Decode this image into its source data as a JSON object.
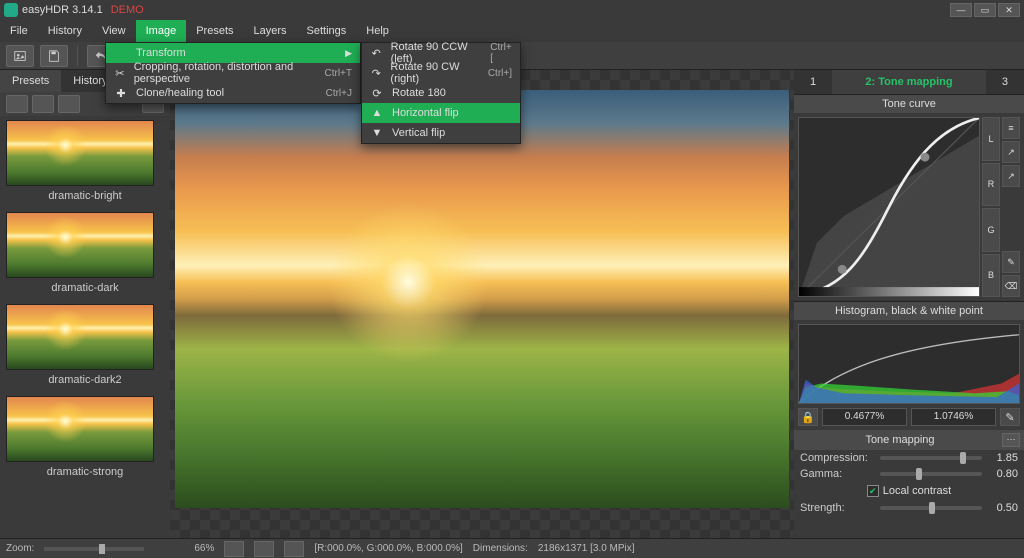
{
  "title": {
    "app": "easyHDR 3.14.1",
    "demo": "DEMO"
  },
  "menubar": [
    "File",
    "History",
    "View",
    "Image",
    "Presets",
    "Layers",
    "Settings",
    "Help"
  ],
  "menubar_active": 3,
  "image_menu": {
    "items": [
      {
        "icon": "",
        "label": "Transform",
        "sub": true
      },
      {
        "icon": "✂",
        "label": "Cropping, rotation, distortion and perspective",
        "shortcut": "Ctrl+T"
      },
      {
        "icon": "✚",
        "label": "Clone/healing tool",
        "shortcut": "Ctrl+J"
      }
    ],
    "active": 0
  },
  "transform_submenu": {
    "items": [
      {
        "icon": "↶",
        "label": "Rotate 90 CCW (left)",
        "shortcut": "Ctrl+["
      },
      {
        "icon": "↷",
        "label": "Rotate 90 CW (right)",
        "shortcut": "Ctrl+]"
      },
      {
        "icon": "⟳",
        "label": "Rotate 180",
        "shortcut": ""
      },
      {
        "icon": "▲",
        "label": "Horizontal flip",
        "shortcut": ""
      },
      {
        "icon": "▼",
        "label": "Vertical flip",
        "shortcut": ""
      }
    ],
    "active": 3
  },
  "left_tabs": {
    "items": [
      "Presets",
      "History"
    ],
    "active": 0
  },
  "presets": [
    {
      "name": "dramatic-bright"
    },
    {
      "name": "dramatic-dark"
    },
    {
      "name": "dramatic-dark2"
    },
    {
      "name": "dramatic-strong"
    }
  ],
  "steps": {
    "one": "1",
    "mid": "2: Tone mapping",
    "three": "3"
  },
  "sections": {
    "tone_curve": "Tone curve",
    "histogram": "Histogram, black & white point",
    "tone_mapping": "Tone mapping"
  },
  "channels": [
    "L",
    "R",
    "G",
    "B"
  ],
  "bw": {
    "black": "0.4677%",
    "white": "1.0746%"
  },
  "tonemap": {
    "compression_label": "Compression:",
    "compression_val": "1.85",
    "gamma_label": "Gamma:",
    "gamma_val": "0.80",
    "local_contrast": "Local contrast",
    "strength_label": "Strength:",
    "strength_val": "0.50"
  },
  "status": {
    "zoom_label": "Zoom:",
    "zoom_pct": "66%",
    "rgb": "[R:000.0%, G:000.0%, B:000.0%]",
    "dim_label": "Dimensions:",
    "dim_val": "2186x1371 [3.0 MPix]"
  }
}
